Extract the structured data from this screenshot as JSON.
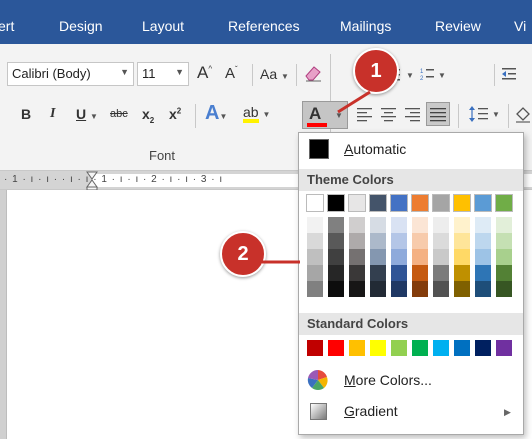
{
  "tabs": [
    "ert",
    "Design",
    "Layout",
    "References",
    "Mailings",
    "Review",
    "Vi"
  ],
  "ribbon": {
    "font_name": "Calibri (Body)",
    "font_size": "11",
    "grow_font": "A",
    "shrink_font": "A",
    "change_case": "Aa",
    "bold": "B",
    "italic": "I",
    "underline": "U",
    "strikethrough": "abc",
    "subscript": "x",
    "subscript_mark": "2",
    "superscript": "x",
    "superscript_mark": "2",
    "text_effects": "A",
    "highlight": "ab",
    "font_color": "A",
    "group_label": "Font"
  },
  "ruler": {
    "text": "· 1 · ı · ı ·    · ı · ı · 1 · ı · ı · 2 · ı · ı · 3 · ı"
  },
  "panel": {
    "automatic_label": "Automatic",
    "automatic_accel": "A",
    "theme_title": "Theme Colors",
    "standard_title": "Standard Colors",
    "more_colors_label": "More Colors...",
    "more_colors_accel": "M",
    "gradient_label": "Gradient",
    "gradient_accel": "G",
    "theme_columns": [
      [
        "#ffffff",
        "#f2f2f2",
        "#d9d9d9",
        "#bfbfbf",
        "#a6a6a6",
        "#808080"
      ],
      [
        "#000000",
        "#808080",
        "#595959",
        "#404040",
        "#262626",
        "#0d0d0d"
      ],
      [
        "#e7e6e6",
        "#d0cece",
        "#aeaaaa",
        "#757171",
        "#3a3838",
        "#171616"
      ],
      [
        "#44546a",
        "#d6dce4",
        "#acb9ca",
        "#8497b0",
        "#333f4f",
        "#222a35"
      ],
      [
        "#4472c4",
        "#d9e2f3",
        "#b4c6e7",
        "#8eaadb",
        "#2f5496",
        "#1f3864"
      ],
      [
        "#ed7d31",
        "#fbe5d5",
        "#f7cbac",
        "#f4b183",
        "#c55a11",
        "#833c0b"
      ],
      [
        "#a5a5a5",
        "#ededed",
        "#dbdbdb",
        "#c9c9c9",
        "#7b7b7b",
        "#525252"
      ],
      [
        "#ffc000",
        "#fff2cc",
        "#fee599",
        "#ffd966",
        "#bf9000",
        "#7f6000"
      ],
      [
        "#5b9bd5",
        "#deebf6",
        "#bdd7ee",
        "#9dc3e6",
        "#2e75b5",
        "#1e4e79"
      ],
      [
        "#70ad47",
        "#e2efd9",
        "#c5e0b3",
        "#a8d08d",
        "#538135",
        "#375623"
      ]
    ],
    "standard_colors": [
      "#c00000",
      "#ff0000",
      "#ffc000",
      "#ffff00",
      "#92d050",
      "#00b050",
      "#00b0f0",
      "#0070c0",
      "#002060",
      "#7030a0"
    ]
  },
  "callouts": {
    "one": "1",
    "two": "2"
  }
}
